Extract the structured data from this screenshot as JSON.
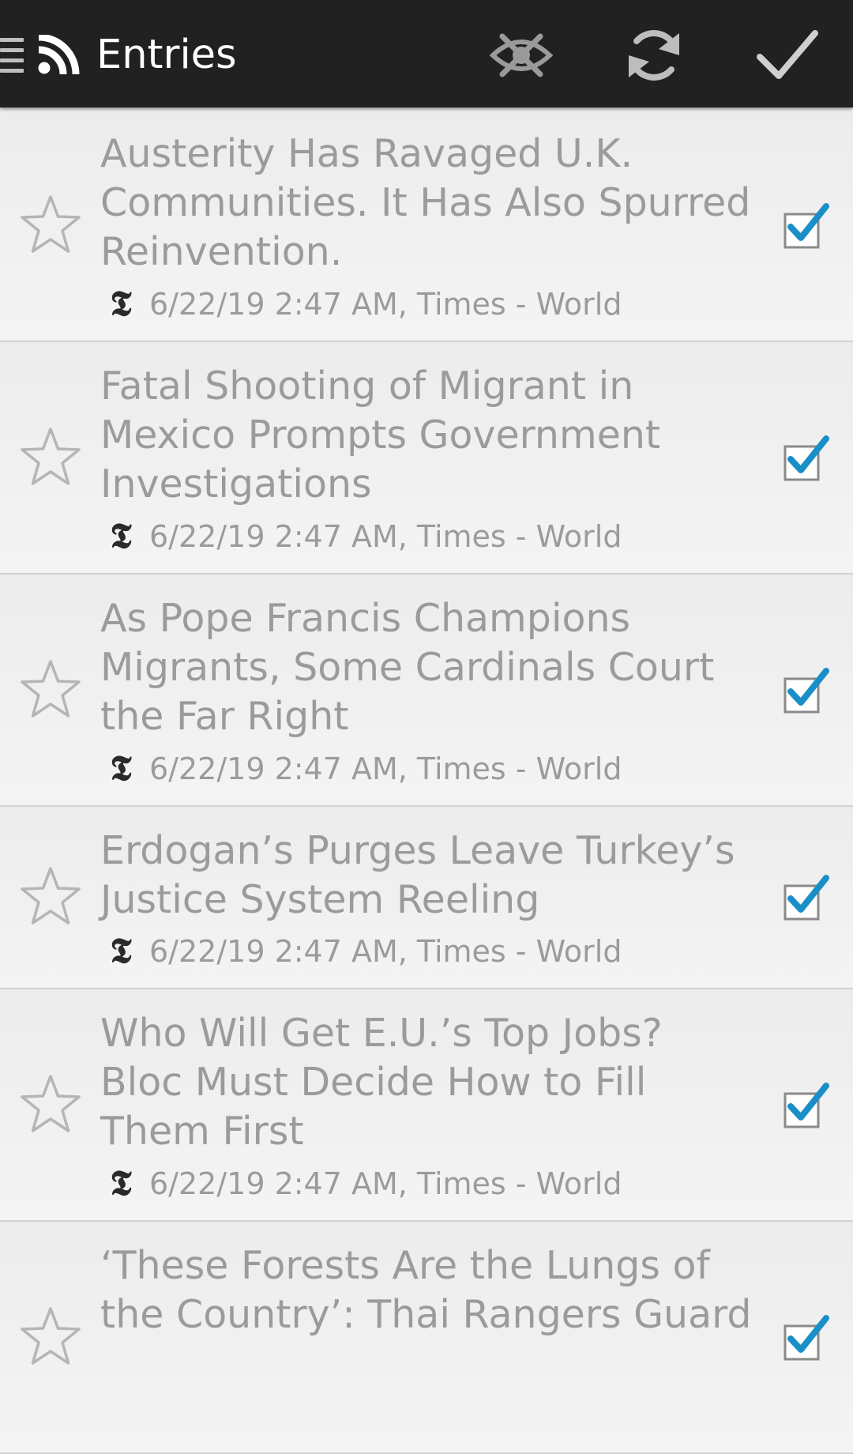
{
  "toolbar": {
    "title": "Entries",
    "menu_icon": "hamburger-menu-icon",
    "app_icon": "rss-feed-icon",
    "actions": [
      {
        "name": "hide-read-button",
        "icon": "eye-crossed-icon"
      },
      {
        "name": "refresh-button",
        "icon": "refresh-icon"
      },
      {
        "name": "mark-all-read-button",
        "icon": "checkmark-icon"
      }
    ]
  },
  "colors": {
    "toolbar_bg": "#212121",
    "list_bg": "#f1f1f1",
    "text_read": "#9b9b9b",
    "check_accent": "#1a8fc7"
  },
  "entries": [
    {
      "title": "Austerity Has Ravaged U.K. Communities. It Has Also Spurred Reinvention.",
      "meta": "6/22/19 2:47 AM, Times - World",
      "feed_icon": "𝕿",
      "starred": false,
      "read": true
    },
    {
      "title": "Fatal Shooting of Migrant in Mexico Prompts Government Investigations",
      "meta": "6/22/19 2:47 AM, Times - World",
      "feed_icon": "𝕿",
      "starred": false,
      "read": true
    },
    {
      "title": "As Pope Francis Champions Migrants, Some Cardinals Court the Far Right",
      "meta": "6/22/19 2:47 AM, Times - World",
      "feed_icon": "𝕿",
      "starred": false,
      "read": true
    },
    {
      "title": "Erdogan’s Purges Leave Turkey’s Justice System Reeling",
      "meta": "6/22/19 2:47 AM, Times - World",
      "feed_icon": "𝕿",
      "starred": false,
      "read": true
    },
    {
      "title": "Who Will Get E.U.’s Top Jobs? Bloc Must Decide How to Fill Them First",
      "meta": "6/22/19 2:47 AM, Times - World",
      "feed_icon": "𝕿",
      "starred": false,
      "read": true
    },
    {
      "title": "‘These Forests Are the Lungs of the Country’: Thai Rangers Guard",
      "meta": "",
      "feed_icon": "",
      "starred": false,
      "read": true
    }
  ]
}
